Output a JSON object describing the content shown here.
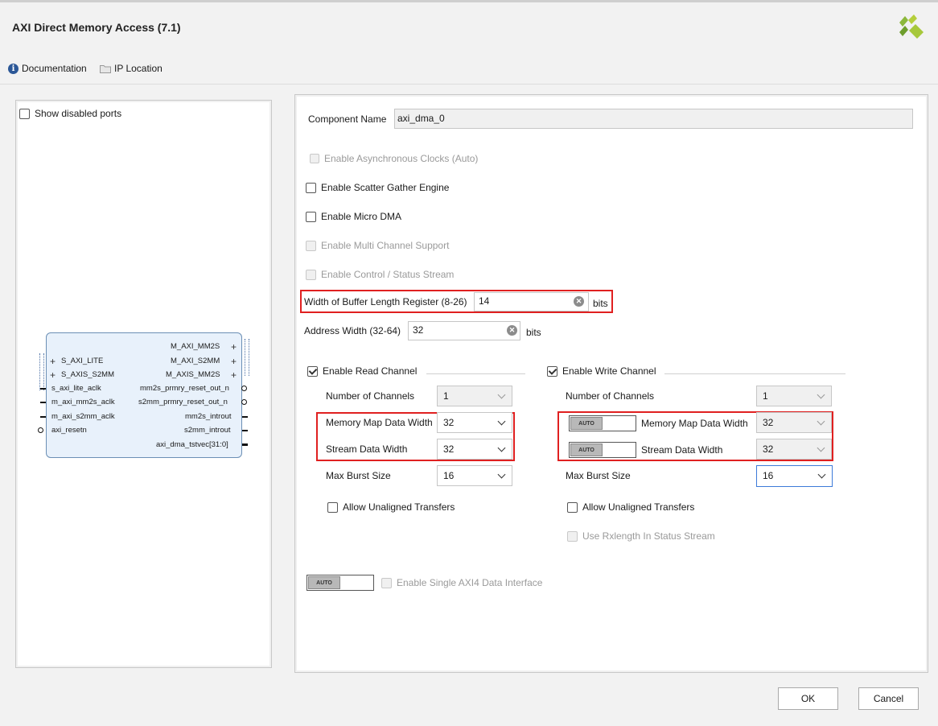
{
  "window": {
    "title": "AXI Direct Memory Access (7.1)"
  },
  "toolbar": {
    "documentation": "Documentation",
    "ip_location": "IP Location"
  },
  "left": {
    "show_disabled_ports": "Show disabled ports",
    "block": {
      "left_ports": [
        "S_AXI_LITE",
        "S_AXIS_S2MM",
        "s_axi_lite_aclk",
        "m_axi_mm2s_aclk",
        "m_axi_s2mm_aclk",
        "axi_resetn"
      ],
      "right_ports": [
        "M_AXI_MM2S",
        "M_AXI_S2MM",
        "M_AXIS_MM2S",
        "mm2s_prmry_reset_out_n",
        "s2mm_prmry_reset_out_n",
        "mm2s_introut",
        "s2mm_introut",
        "axi_dma_tstvec[31:0]"
      ]
    }
  },
  "form": {
    "component_name_label": "Component Name",
    "component_name_value": "axi_dma_0",
    "enable_async_clocks": "Enable Asynchronous Clocks (Auto)",
    "enable_scatter_gather": "Enable Scatter Gather Engine",
    "enable_micro_dma": "Enable Micro DMA",
    "enable_multi_channel": "Enable Multi Channel Support",
    "enable_control_status": "Enable Control / Status Stream",
    "buffer_length_label": "Width of Buffer Length Register (8-26)",
    "buffer_length_value": "14",
    "buffer_length_unit": "bits",
    "address_width_label": "Address Width (32-64)",
    "address_width_value": "32",
    "address_width_unit": "bits",
    "read": {
      "title": "Enable Read Channel",
      "num_channels_label": "Number of Channels",
      "num_channels_value": "1",
      "mm_data_width_label": "Memory Map Data Width",
      "mm_data_width_value": "32",
      "stream_data_width_label": "Stream Data Width",
      "stream_data_width_value": "32",
      "max_burst_label": "Max Burst Size",
      "max_burst_value": "16",
      "unaligned_label": "Allow Unaligned Transfers"
    },
    "write": {
      "title": "Enable Write Channel",
      "num_channels_label": "Number of Channels",
      "num_channels_value": "1",
      "mm_data_width_label": "Memory Map Data Width",
      "mm_data_width_value": "32",
      "stream_data_width_label": "Stream Data Width",
      "stream_data_width_value": "32",
      "max_burst_label": "Max Burst Size",
      "max_burst_value": "16",
      "unaligned_label": "Allow Unaligned Transfers",
      "rxlength_label": "Use Rxlength In Status Stream"
    },
    "auto_label": "AUTO",
    "single_axi4_label": "Enable Single AXI4 Data Interface"
  },
  "buttons": {
    "ok": "OK",
    "cancel": "Cancel"
  },
  "colors": {
    "highlight": "#e02020",
    "focus": "#3d7bd9",
    "logo": "#8cb83c"
  },
  "icons": {
    "info": "info-icon",
    "folder": "folder-icon",
    "clear": "clear-icon",
    "chevron": "chevron-down-icon"
  }
}
